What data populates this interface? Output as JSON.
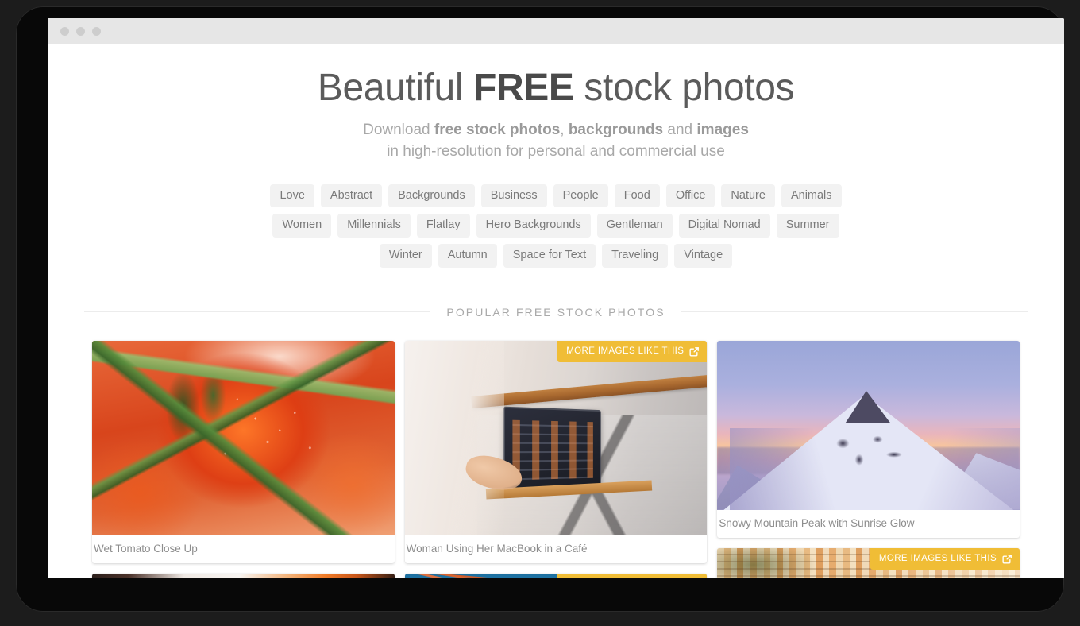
{
  "window": {
    "traffic_lights": [
      "close",
      "minimize",
      "zoom"
    ]
  },
  "hero": {
    "title_part_1": "Beautiful ",
    "title_emphasis": "FREE",
    "title_part_2": " stock photos",
    "subtitle_line_1_a": "Download ",
    "subtitle_line_1_b": "free stock photos",
    "subtitle_line_1_c": ", ",
    "subtitle_line_1_d": "backgrounds",
    "subtitle_line_1_e": " and ",
    "subtitle_line_1_f": "images",
    "subtitle_line_2": "in high-resolution for personal and commercial use"
  },
  "tags": [
    "Love",
    "Abstract",
    "Backgrounds",
    "Business",
    "People",
    "Food",
    "Office",
    "Nature",
    "Animals",
    "Women",
    "Millennials",
    "Flatlay",
    "Hero Backgrounds",
    "Gentleman",
    "Digital Nomad",
    "Summer",
    "Winter",
    "Autumn",
    "Space for Text",
    "Traveling",
    "Vintage"
  ],
  "section": {
    "heading": "POPULAR FREE STOCK PHOTOS"
  },
  "badge": {
    "label": "MORE IMAGES LIKE THIS",
    "icon": "external-link-icon",
    "color": "#f0bd36"
  },
  "gallery": {
    "columns": [
      {
        "cards": [
          {
            "caption": "Wet Tomato Close Up",
            "has_badge": false,
            "art": "tomato"
          },
          {
            "caption": "",
            "has_badge": false,
            "art": "abstract"
          }
        ]
      },
      {
        "cards": [
          {
            "caption": "Woman Using Her MacBook in a Café",
            "has_badge": true,
            "art": "cafe"
          },
          {
            "caption": "",
            "has_badge": true,
            "art": "cables"
          }
        ]
      },
      {
        "cards": [
          {
            "caption": "Snowy Mountain Peak with Sunrise Glow",
            "has_badge": false,
            "art": "mountain"
          },
          {
            "caption": "",
            "has_badge": true,
            "art": "village"
          }
        ]
      }
    ]
  },
  "colors": {
    "page_background": "#ffffff",
    "title_bar": "#e6e6e6",
    "device_frame": "#1c1c1c",
    "tag_background": "#f2f2f2",
    "tag_text": "#7a7a7a",
    "heading_text": "#5b5b5b",
    "caption_text": "#8d8d8d",
    "accent": "#f0bd36"
  }
}
